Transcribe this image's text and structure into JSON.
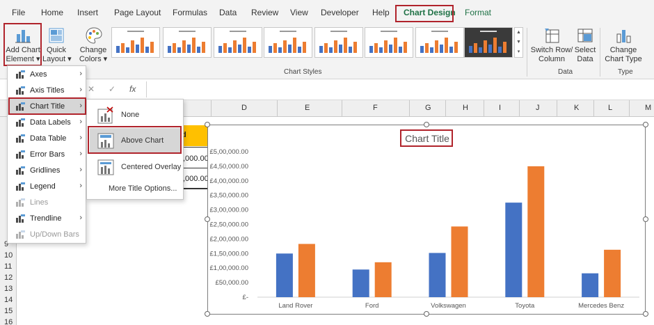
{
  "ribbon_tabs": [
    "File",
    "Home",
    "Insert",
    "Page Layout",
    "Formulas",
    "Data",
    "Review",
    "View",
    "Developer",
    "Help",
    "Chart Design",
    "Format"
  ],
  "ribbon": {
    "add_chart_element": "Add Chart Element",
    "add_chart_element_line1": "Add Chart",
    "add_chart_element_line2": "Element ▾",
    "quick_layout_line1": "Quick",
    "quick_layout_line2": "Layout ▾",
    "change_colors_line1": "Change",
    "change_colors_line2": "Colors ▾",
    "chart_styles_group": "Chart Styles",
    "switch_row_col_line1": "Switch Row/",
    "switch_row_col_line2": "Column",
    "select_data_line1": "Select",
    "select_data_line2": "Data",
    "data_group": "Data",
    "change_chart_type_line1": "Change",
    "change_chart_type_line2": "Chart Type",
    "type_group": "Type"
  },
  "formula_bar": {
    "fx": "fx"
  },
  "columns": [
    "D",
    "E",
    "F",
    "G",
    "H",
    "I",
    "J",
    "K",
    "L",
    "M"
  ],
  "rows": [
    "9",
    "10",
    "11",
    "12",
    "13",
    "14",
    "15",
    "16"
  ],
  "partial_cells": {
    "header_fragment": "d",
    "value1": ",000.00",
    "value2": ",000.00"
  },
  "menu_items": [
    {
      "label": "Axes",
      "disabled": false,
      "icon": "axes-icon"
    },
    {
      "label": "Axis Titles",
      "disabled": false,
      "icon": "axis-titles-icon"
    },
    {
      "label": "Chart Title",
      "disabled": false,
      "icon": "chart-title-icon"
    },
    {
      "label": "Data Labels",
      "disabled": false,
      "icon": "data-labels-icon"
    },
    {
      "label": "Data Table",
      "disabled": false,
      "icon": "data-table-icon"
    },
    {
      "label": "Error Bars",
      "disabled": false,
      "icon": "error-bars-icon"
    },
    {
      "label": "Gridlines",
      "disabled": false,
      "icon": "gridlines-icon"
    },
    {
      "label": "Legend",
      "disabled": false,
      "icon": "legend-icon"
    },
    {
      "label": "Lines",
      "disabled": true,
      "icon": "lines-icon"
    },
    {
      "label": "Trendline",
      "disabled": false,
      "icon": "trendline-icon"
    },
    {
      "label": "Up/Down Bars",
      "disabled": true,
      "icon": "up-down-bars-icon"
    }
  ],
  "submenu": {
    "none": "None",
    "above_chart": "Above Chart",
    "centered_overlay": "Centered Overlay",
    "more_options": "More Title Options..."
  },
  "chart_data": {
    "type": "bar",
    "title": "Chart Title",
    "categories": [
      "Land Rover",
      "Ford",
      "Volkswagen",
      "Toyota",
      "Mercedes Benz"
    ],
    "series": [
      {
        "color": "#4472c4",
        "values": [
          150000,
          95000,
          152000,
          325000,
          82000
        ]
      },
      {
        "color": "#ed7d31",
        "values": [
          183000,
          120000,
          243000,
          450000,
          163000
        ]
      }
    ],
    "yticks": [
      "£-",
      "£50,000.00",
      "£1,00,000.00",
      "£1,50,000.00",
      "£2,00,000.00",
      "£2,50,000.00",
      "£3,00,000.00",
      "£3,50,000.00",
      "£4,00,000.00",
      "£4,50,000.00",
      "£5,00,000.00"
    ],
    "ylim": [
      0,
      500000
    ],
    "grid": false
  },
  "colors": {
    "accent_green": "#1e7145",
    "highlight_red": "#b0232b",
    "series_blue": "#4472c4",
    "series_orange": "#ed7d31"
  }
}
